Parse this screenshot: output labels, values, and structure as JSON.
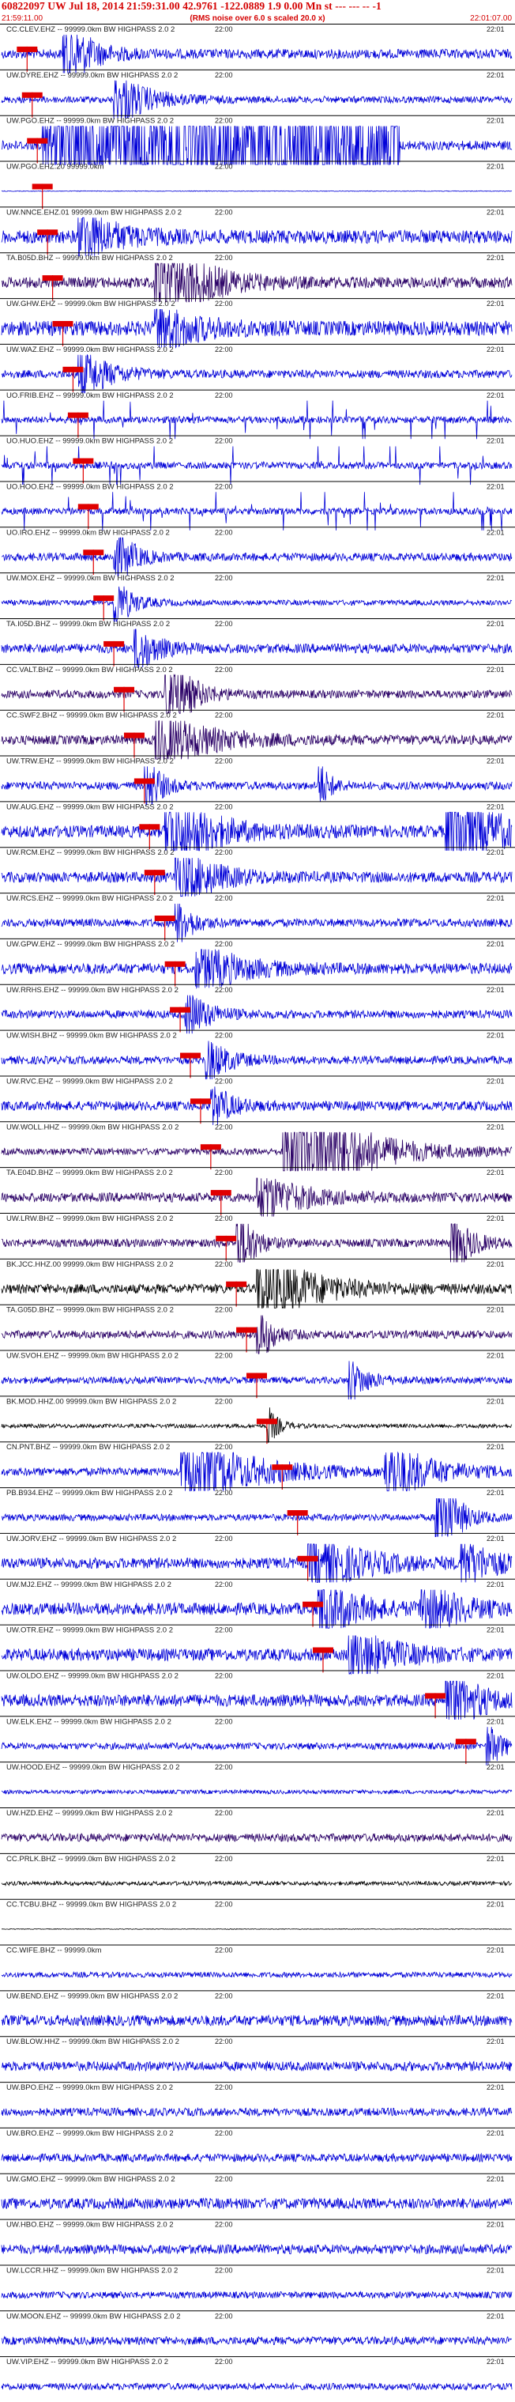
{
  "header": {
    "title": "60822097 UW Jul 18, 2014 21:59:31.00   42.9761 -122.0889  1.9 0.00 Mn st --- --- -- -1",
    "subtitle": "(RMS noise over 6.0 s scaled 20.0 x)",
    "start_time": "21:59:11.00",
    "end_time": "22:01:07.00"
  },
  "tick_labels": {
    "mid": "22:00",
    "end": "22:01"
  },
  "colors": {
    "header_red": "#d40000",
    "pick_red": "#e00000",
    "trace_blue": "#0000d8",
    "trace_dark": "#2a0066",
    "trace_black": "#000000"
  },
  "traces": [
    {
      "label": "CC.CLEV.EHZ -- 99999.0km BW  HIGHPASS  2.0  2",
      "color": "blue",
      "amp": 0.7,
      "pick": 0.05,
      "bursts": [
        [
          0.12,
          0.07,
          2.2
        ]
      ]
    },
    {
      "label": "UW.DYRE.EHZ -- 99999.0km BW  HIGHPASS  2.0  2",
      "color": "blue",
      "amp": 0.5,
      "pick": 0.06,
      "bursts": [
        [
          0.22,
          0.09,
          1.6
        ]
      ]
    },
    {
      "label": "UW.PGO.EHZ -- 99999.0km BW  HIGHPASS  2.0  2",
      "color": "blue",
      "amp": 0.7,
      "pick": 0.07,
      "bursts": [],
      "band": [
        0.08,
        0.78,
        3.2
      ]
    },
    {
      "label": "UW.PGO.EHZ.20 99999.0km",
      "color": "blue",
      "amp": 0.05,
      "pick": 0.08,
      "bursts": []
    },
    {
      "label": "UW.NNCE.EHZ.01 99999.0km BW  HIGHPASS  2.0  2",
      "color": "blue",
      "amp": 1.0,
      "pick": 0.09,
      "bursts": [
        [
          0.15,
          0.1,
          1.6
        ]
      ]
    },
    {
      "label": "TA.B05D.BHZ -- 99999.0km BW  HIGHPASS  2.0  2",
      "color": "dark",
      "amp": 0.8,
      "pick": 0.1,
      "bursts": [
        [
          0.3,
          0.12,
          3.0
        ]
      ]
    },
    {
      "label": "UW.GHW.EHZ -- 99999.0km BW  HIGHPASS  2.0  2",
      "color": "blue",
      "amp": 1.1,
      "pick": 0.12,
      "bursts": [
        [
          0.3,
          0.1,
          1.5
        ]
      ]
    },
    {
      "label": "UW.WAZ.EHZ -- 99999.0km BW  HIGHPASS  2.0  2",
      "color": "blue",
      "amp": 0.6,
      "pick": 0.14,
      "bursts": [
        [
          0.15,
          0.08,
          1.5
        ]
      ]
    },
    {
      "label": "UO.FRIB.EHZ -- 99999.0km BW  HIGHPASS  2.0  2",
      "color": "blue",
      "amp": 0.5,
      "pick": 0.15,
      "bursts": [],
      "spikes": true
    },
    {
      "label": "UO.HUO.EHZ -- 99999.0km BW  HIGHPASS  2.0  2",
      "color": "blue",
      "amp": 0.5,
      "pick": 0.16,
      "bursts": [],
      "spikes": true
    },
    {
      "label": "UO.HOO.EHZ -- 99999.0km BW  HIGHPASS  2.0  2",
      "color": "blue",
      "amp": 0.5,
      "pick": 0.17,
      "bursts": [],
      "spikes": true
    },
    {
      "label": "UO.IRO.EHZ -- 99999.0km BW  HIGHPASS  2.0  2",
      "color": "blue",
      "amp": 0.6,
      "pick": 0.18,
      "bursts": [
        [
          0.22,
          0.05,
          1.8
        ]
      ]
    },
    {
      "label": "UW.MOX.EHZ -- 99999.0km BW  HIGHPASS  2.0  2",
      "color": "blue",
      "amp": 0.4,
      "pick": 0.2,
      "bursts": [
        [
          0.22,
          0.05,
          1.5
        ]
      ]
    },
    {
      "label": "TA.I05D.BHZ -- 99999.0km BW  HIGHPASS  2.0  2",
      "color": "blue",
      "amp": 0.7,
      "pick": 0.22,
      "bursts": [
        [
          0.26,
          0.06,
          1.4
        ]
      ]
    },
    {
      "label": "CC.VALT.BHZ -- 99999.0km BW  HIGHPASS  2.0  2",
      "color": "dark",
      "amp": 0.6,
      "pick": 0.24,
      "bursts": [
        [
          0.32,
          0.06,
          3.0
        ]
      ]
    },
    {
      "label": "CC.SWF2.BHZ -- 99999.0km BW  HIGHPASS  2.0  2",
      "color": "dark",
      "amp": 0.7,
      "pick": 0.26,
      "bursts": [
        [
          0.3,
          0.15,
          1.6
        ]
      ]
    },
    {
      "label": "UW.TRW.EHZ -- 99999.0km BW  HIGHPASS  2.0  2",
      "color": "blue",
      "amp": 0.6,
      "pick": 0.28,
      "bursts": [
        [
          0.28,
          0.04,
          2.0
        ],
        [
          0.62,
          0.03,
          1.5
        ]
      ]
    },
    {
      "label": "UW.AUG.EHZ -- 99999.0km BW  HIGHPASS  2.0  2",
      "color": "blue",
      "amp": 0.9,
      "pick": 0.29,
      "bursts": [
        [
          0.32,
          0.12,
          2.4
        ],
        [
          0.87,
          0.13,
          2.6
        ]
      ]
    },
    {
      "label": "UW.RCM.EHZ -- 99999.0km BW  HIGHPASS  2.0  2",
      "color": "blue",
      "amp": 0.8,
      "pick": 0.3,
      "bursts": [
        [
          0.34,
          0.1,
          1.8
        ]
      ]
    },
    {
      "label": "UW.RCS.EHZ -- 99999.0km BW  HIGHPASS  2.0  2",
      "color": "blue",
      "amp": 0.6,
      "pick": 0.32,
      "bursts": [
        [
          0.34,
          0.04,
          1.8
        ]
      ]
    },
    {
      "label": "UW.GPW.EHZ -- 99999.0km BW  HIGHPASS  2.0  2",
      "color": "blue",
      "amp": 0.8,
      "pick": 0.34,
      "bursts": [
        [
          0.38,
          0.12,
          1.4
        ]
      ]
    },
    {
      "label": "UW.RRHS.EHZ -- 99999.0km BW  HIGHPASS  2.0  2",
      "color": "blue",
      "amp": 0.6,
      "pick": 0.35,
      "bursts": [
        [
          0.36,
          0.06,
          1.5
        ]
      ]
    },
    {
      "label": "UW.WISH.BHZ -- 99999.0km BW  HIGHPASS  2.0  2",
      "color": "blue",
      "amp": 0.6,
      "pick": 0.37,
      "bursts": [
        [
          0.4,
          0.06,
          1.3
        ]
      ]
    },
    {
      "label": "UW.RVC.EHZ -- 99999.0km BW  HIGHPASS  2.0  2",
      "color": "blue",
      "amp": 0.7,
      "pick": 0.39,
      "bursts": [
        [
          0.41,
          0.05,
          1.4
        ]
      ]
    },
    {
      "label": "UW.WOLL.HHZ -- 99999.0km BW  HIGHPASS  2.0  2",
      "color": "dark",
      "amp": 0.5,
      "pick": 0.41,
      "bursts": [
        [
          0.55,
          0.17,
          4.5
        ]
      ]
    },
    {
      "label": "TA.E04D.BHZ -- 99999.0km BW  HIGHPASS  2.0  2",
      "color": "dark",
      "amp": 0.7,
      "pick": 0.43,
      "bursts": [
        [
          0.5,
          0.12,
          1.4
        ]
      ]
    },
    {
      "label": "UW.LRW.BHZ -- 99999.0km BW  HIGHPASS  2.0  2",
      "color": "dark",
      "amp": 0.6,
      "pick": 0.44,
      "bursts": [
        [
          0.46,
          0.04,
          2.8
        ],
        [
          0.88,
          0.05,
          2.0
        ]
      ]
    },
    {
      "label": "BK.JCC.HHZ.00 99999.0km BW  HIGHPASS  2.0  2",
      "color": "black",
      "amp": 0.7,
      "pick": 0.46,
      "bursts": [
        [
          0.5,
          0.14,
          2.4
        ]
      ]
    },
    {
      "label": "TA.G05D.BHZ -- 99999.0km BW  HIGHPASS  2.0  2",
      "color": "dark",
      "amp": 0.6,
      "pick": 0.48,
      "bursts": [
        [
          0.5,
          0.04,
          1.8
        ]
      ]
    },
    {
      "label": "UW.SVOH.EHZ -- 99999.0km BW  HIGHPASS  2.0  2",
      "color": "blue",
      "amp": 0.5,
      "pick": 0.5,
      "bursts": [
        [
          0.68,
          0.05,
          1.3
        ]
      ]
    },
    {
      "label": "BK.MOD.HHZ.00 99999.0km BW  HIGHPASS  2.0  2",
      "color": "black",
      "amp": 0.3,
      "pick": 0.52,
      "bursts": [
        [
          0.52,
          0.03,
          1.2
        ]
      ]
    },
    {
      "label": "CN.PNT.BHZ -- 99999.0km BW  HIGHPASS  2.0  2",
      "color": "blue",
      "amp": 0.6,
      "pick": 0.55,
      "bursts": [
        [
          0.35,
          0.18,
          2.2
        ],
        [
          0.75,
          0.12,
          1.8
        ]
      ]
    },
    {
      "label": "PB.B934.EHZ -- 99999.0km BW  HIGHPASS  2.0  2",
      "color": "blue",
      "amp": 0.5,
      "pick": 0.58,
      "bursts": [
        [
          0.85,
          0.05,
          3.5
        ]
      ]
    },
    {
      "label": "UW.JORV.EHZ -- 99999.0km BW  HIGHPASS  2.0  2",
      "color": "blue",
      "amp": 0.8,
      "pick": 0.6,
      "bursts": [
        [
          0.6,
          0.14,
          1.8
        ],
        [
          0.9,
          0.08,
          1.5
        ]
      ]
    },
    {
      "label": "UW.MJ2.EHZ -- 99999.0km BW  HIGHPASS  2.0  2",
      "color": "blue",
      "amp": 0.9,
      "pick": 0.61,
      "bursts": [
        [
          0.62,
          0.1,
          1.8
        ],
        [
          0.82,
          0.1,
          1.6
        ]
      ]
    },
    {
      "label": "UW.OTR.EHZ -- 99999.0km BW  HIGHPASS  2.0  2",
      "color": "blue",
      "amp": 0.9,
      "pick": 0.63,
      "bursts": [
        [
          0.68,
          0.12,
          1.6
        ]
      ]
    },
    {
      "label": "UW.OLDO.EHZ -- 99999.0km BW  HIGHPASS  2.0  2",
      "color": "blue",
      "amp": 0.9,
      "pick": 0.85,
      "bursts": [
        [
          0.87,
          0.08,
          2.2
        ]
      ]
    },
    {
      "label": "UW.ELK.EHZ -- 99999.0km BW  HIGHPASS  2.0  2",
      "color": "blue",
      "amp": 0.5,
      "pick": 0.91,
      "bursts": [
        [
          0.95,
          0.04,
          1.5
        ]
      ]
    },
    {
      "label": "UW.HOOD.EHZ -- 99999.0km BW  HIGHPASS  2.0  2",
      "color": "blue",
      "amp": 0.3,
      "pick": -1,
      "bursts": []
    },
    {
      "label": "UW.HZD.EHZ -- 99999.0km BW  HIGHPASS  2.0  2",
      "color": "dark",
      "amp": 0.6,
      "pick": -1,
      "bursts": []
    },
    {
      "label": "CC.PRLK.BHZ -- 99999.0km BW  HIGHPASS  2.0  2",
      "color": "black",
      "amp": 0.3,
      "pick": -1,
      "bursts": []
    },
    {
      "label": "CC.TCBU.BHZ -- 99999.0km BW  HIGHPASS  2.0  2",
      "color": "black",
      "amp": 0.05,
      "pick": -1,
      "bursts": []
    },
    {
      "label": "CC.WIFE.BHZ -- 99999.0km",
      "color": "blue",
      "amp": 0.4,
      "pick": -1,
      "bursts": []
    },
    {
      "label": "UW.BEND.EHZ -- 99999.0km BW  HIGHPASS  2.0  2",
      "color": "blue",
      "amp": 0.8,
      "pick": -1,
      "bursts": []
    },
    {
      "label": "UW.BLOW.HHZ -- 99999.0km BW  HIGHPASS  2.0  2",
      "color": "blue",
      "amp": 0.7,
      "pick": -1,
      "bursts": []
    },
    {
      "label": "UW.BPO.EHZ -- 99999.0km BW  HIGHPASS  2.0  2",
      "color": "blue",
      "amp": 0.6,
      "pick": -1,
      "bursts": []
    },
    {
      "label": "UW.BRO.EHZ -- 99999.0km BW  HIGHPASS  2.0  2",
      "color": "blue",
      "amp": 0.6,
      "pick": -1,
      "bursts": []
    },
    {
      "label": "UW.GMO.EHZ -- 99999.0km BW  HIGHPASS  2.0  2",
      "color": "blue",
      "amp": 0.8,
      "pick": -1,
      "bursts": []
    },
    {
      "label": "UW.HBO.EHZ -- 99999.0km BW  HIGHPASS  2.0  2",
      "color": "blue",
      "amp": 0.7,
      "pick": -1,
      "bursts": []
    },
    {
      "label": "UW.LCCR.HHZ -- 99999.0km BW  HIGHPASS  2.0  2",
      "color": "blue",
      "amp": 0.5,
      "pick": -1,
      "bursts": []
    },
    {
      "label": "UW.MOON.EHZ -- 99999.0km BW  HIGHPASS  2.0  2",
      "color": "blue",
      "amp": 0.6,
      "pick": -1,
      "bursts": []
    },
    {
      "label": "UW.VIP.EHZ -- 99999.0km BW  HIGHPASS  2.0  2",
      "color": "blue",
      "amp": 0.5,
      "pick": -1,
      "bursts": []
    }
  ]
}
